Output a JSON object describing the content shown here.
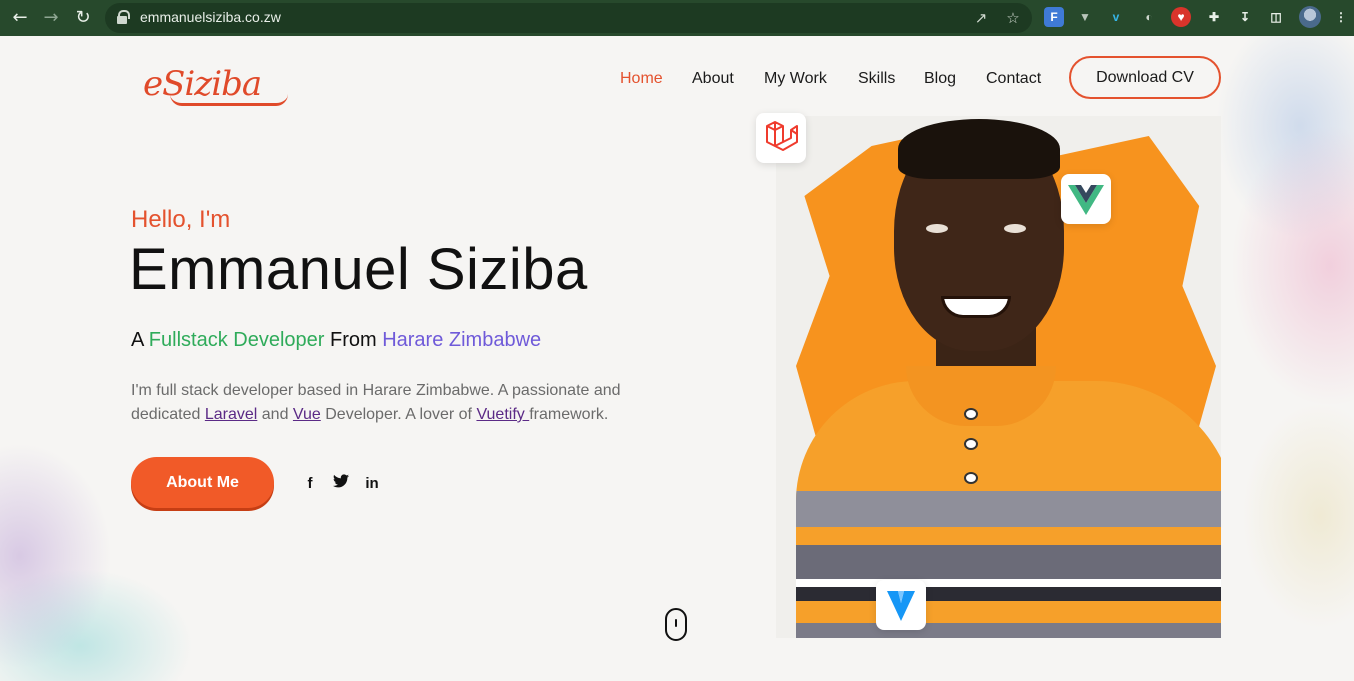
{
  "browser": {
    "url": "emmanuelsiziba.co.zw",
    "extensions": [
      "translate-icon",
      "vuetify-devtools-icon",
      "vimeo-icon",
      "globe-icon",
      "shield-icon",
      "puzzle-icon",
      "download-icon",
      "sidepanel-icon"
    ],
    "ext_labels": {
      "translate": "F",
      "vimeo": "v"
    }
  },
  "site": {
    "logo_text": "eSiziba",
    "nav": [
      {
        "label": "Home",
        "active": true
      },
      {
        "label": "About"
      },
      {
        "label": "My Work"
      },
      {
        "label": "Skills"
      },
      {
        "label": "Blog"
      },
      {
        "label": "Contact"
      }
    ],
    "download_cv": "Download CV"
  },
  "hero": {
    "greeting": "Hello, I'm",
    "name": "Emmanuel Siziba",
    "tagline_prefix": "A ",
    "tagline_role": "Fullstack Developer",
    "tagline_mid": " From ",
    "tagline_place": "Harare Zimbabwe",
    "bio_1": "I'm full stack developer based in Harare Zimbabwe. A passionate and dedicated ",
    "bio_link_laravel": "Laravel",
    "bio_2": " and ",
    "bio_link_vue": "Vue",
    "bio_3": " Developer. A lover of ",
    "bio_link_vuetify": "Vuetify ",
    "bio_4": "framework.",
    "about_button": "About Me",
    "social": {
      "facebook": "f",
      "twitter": "🐦",
      "linkedin": "in"
    }
  },
  "colors": {
    "accent": "#e4522e",
    "button": "#f15a28",
    "green": "#2fab5a",
    "purple": "#6f5ad9",
    "chrome": "#27492c",
    "splash": "#f7931e"
  }
}
